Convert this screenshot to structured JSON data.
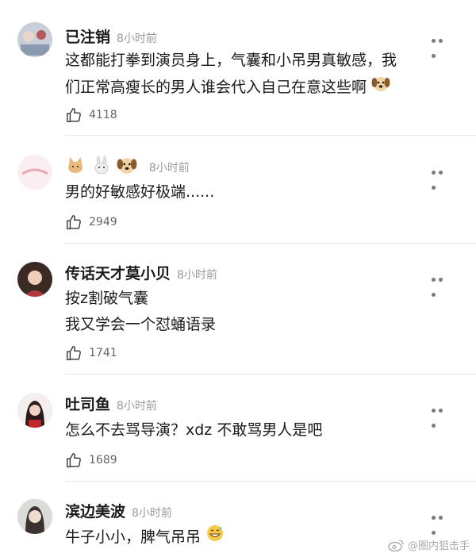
{
  "comments": [
    {
      "name": "已注销",
      "time": "8小时前",
      "lines": [
        "这都能打拳到演员身上，气囊和小吊男真敏感，我",
        "们正常高瘦长的男人谁会代入自己在意这些啊"
      ],
      "likes": "4118"
    },
    {
      "name": "",
      "time": "8小时前",
      "lines": [
        "男的好敏感好极端......"
      ],
      "likes": "2949"
    },
    {
      "name": "传话天才莫小贝",
      "time": "8小时前",
      "lines": [
        "按z割破气囊",
        "我又学会一个怼蛹语录"
      ],
      "likes": "1741"
    },
    {
      "name": "吐司鱼",
      "time": "8小时前",
      "lines": [
        "怎么不去骂导演？xdz 不敢骂男人是吧"
      ],
      "likes": "1689"
    },
    {
      "name": "滨边美波",
      "time": "8小时前",
      "lines": [
        "牛子小小，脾气吊吊"
      ],
      "likes": ""
    }
  ],
  "watermark": "@圈内狙击手",
  "icons": {
    "like": "thumbs-up-icon",
    "more": "more-dots-icon",
    "weibo": "weibo-icon",
    "emoji_dog": "dog-face-emoji",
    "emoji_sweat": "grinning-sweat-emoji",
    "emoji_cat": "cat-emoji",
    "emoji_rabbit": "rabbit-emoji"
  },
  "colors": {
    "text": "#1a1a1a",
    "muted": "#9a9a9a",
    "divider": "#e6e6e6"
  }
}
